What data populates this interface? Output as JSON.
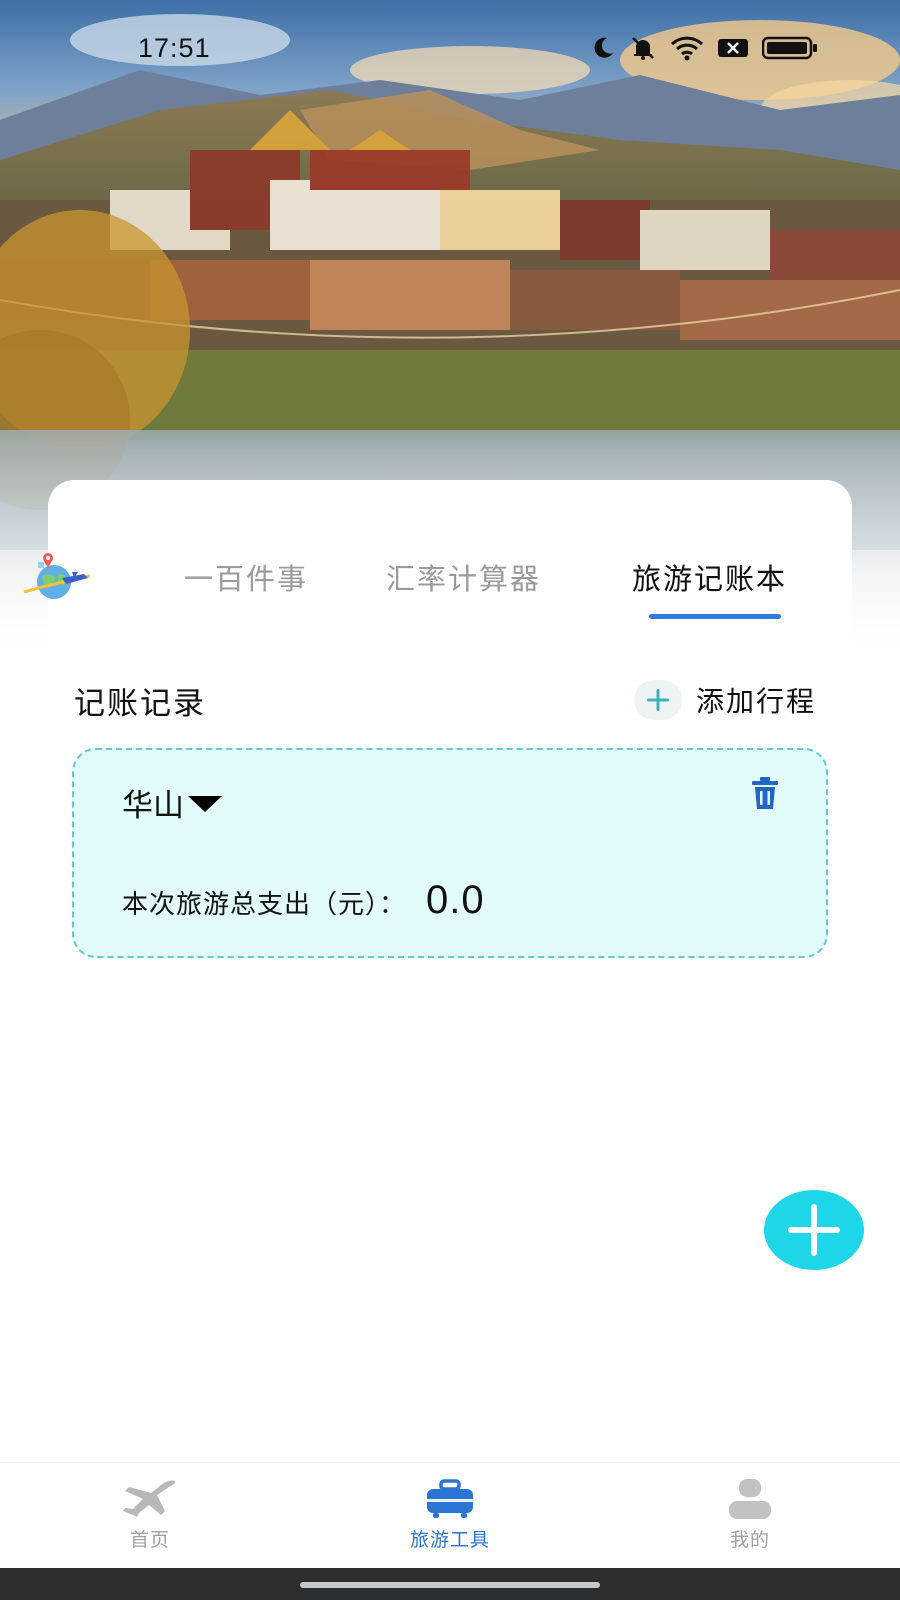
{
  "status_bar": {
    "time": "17:51",
    "icons": [
      "moon-icon",
      "bell-muted-icon",
      "wifi-icon",
      "sim-x-icon",
      "battery-icon"
    ]
  },
  "tabs": {
    "items": [
      {
        "label": "一百件事",
        "active": false
      },
      {
        "label": "汇率计算器",
        "active": false
      },
      {
        "label": "旅游记账本",
        "active": true
      }
    ],
    "accent_color": "#2e7ce0"
  },
  "section": {
    "title": "记账记录",
    "add_label": "添加行程"
  },
  "trip": {
    "name": "华山",
    "expense_label": "本次旅游总支出（元）：",
    "expense_value": "0.0"
  },
  "fab": {
    "icon": "plus-icon",
    "color": "#1dd7e8"
  },
  "bottom_nav": {
    "items": [
      {
        "label": "首页",
        "icon": "airplane-icon",
        "active": false
      },
      {
        "label": "旅游工具",
        "icon": "suitcase-icon",
        "active": true
      },
      {
        "label": "我的",
        "icon": "user-icon",
        "active": false
      }
    ],
    "active_color": "#2a74d4"
  }
}
